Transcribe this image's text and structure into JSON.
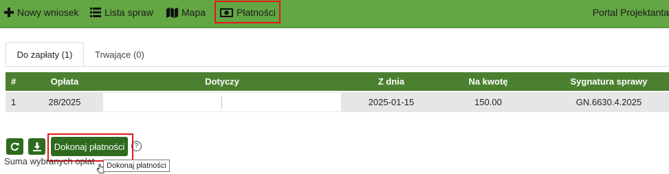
{
  "nav": {
    "new_request": "Nowy wniosek",
    "case_list": "Lista spraw",
    "map": "Mapa",
    "payments": "Płatności",
    "portal_title": "Portal Projektanta"
  },
  "tabs": {
    "to_pay": "Do zapłaty (1)",
    "ongoing": "Trwające (0)"
  },
  "table": {
    "headers": [
      "#",
      "Opłata",
      "Dotyczy",
      "Z dnia",
      "Na kwotę",
      "Sygnatura sprawy"
    ],
    "rows": [
      [
        "1",
        "28/2025",
        "",
        "2025-01-15",
        "150.00",
        "GN.6630.4.2025"
      ]
    ]
  },
  "actions": {
    "pay_button": "Dokonaj płatności",
    "help": "?",
    "tooltip": "Dokonaj płatności"
  },
  "summary": {
    "label": "Suma wybranych opłat"
  },
  "colors": {
    "topbar": "#63a644",
    "table_header": "#4a8030",
    "button": "#2e6b1f",
    "highlight": "#e8141a"
  }
}
